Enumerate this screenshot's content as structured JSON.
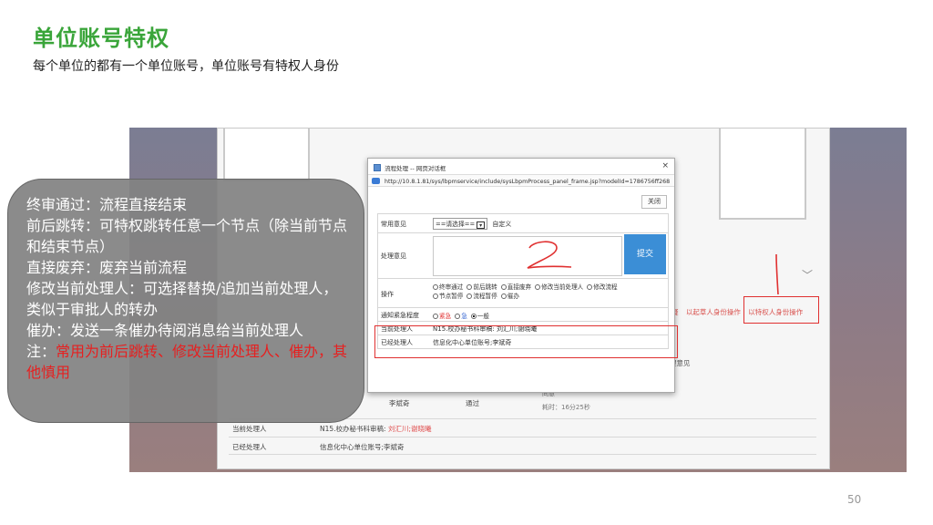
{
  "slide": {
    "title": "单位账号特权",
    "subtitle": "每个单位的都有一个单位账号，单位账号有特权人身份",
    "page_number": "50"
  },
  "callout": {
    "lines": [
      "终审通过：流程直接结束",
      "前后跳转：可特权跳转任意一个节点（除当前节点和结束节点）",
      "直接废弃：废弃当前流程",
      "修改当前处理人：可选择替换/追加当前处理人，类似于审批人的转办",
      "催办：发送一条催办待阅消息给当前处理人"
    ],
    "note_prefix": "注：",
    "note_text": "常用为前后跳转、修改当前处理人、催办，其他慎用"
  },
  "dialog": {
    "title": "流程处理 -- 网页对话框",
    "close_glyph": "×",
    "url": "http://10.8.1.81/sys/lbpmservice/include/sysLbpmProcess_panel_frame.jsp?modelId=1786756ff268",
    "close_button": "关闭",
    "common_opinion_label": "常用意见",
    "common_opinion_select": "==请选择==",
    "common_opinion_custom": "自定义",
    "handle_opinion_label": "处理意见",
    "submit_button": "提交",
    "operation_label": "操作",
    "operations": [
      "终审通过",
      "前后跳转",
      "直接废弃",
      "修改当前处理人",
      "修改流程",
      "节点暂停",
      "流程暂停",
      "催办"
    ],
    "urgency_label": "通知紧急程度",
    "urgency_options": [
      "紧急",
      "急",
      "一般"
    ],
    "current_handler_label": "当前处理人",
    "current_handler_value": "N15.校办秘书科审稿: 刘汇川;谢晓曦",
    "past_handler_label": "已经处理人",
    "past_handler_value": "信息化中心单位账号;李斌奇"
  },
  "background": {
    "links": [
      "疑",
      "以起草人身份操作",
      "以特权人身份操作"
    ],
    "opinion_header": "理意见",
    "name": "李斌奇",
    "status": "通过",
    "elapsed_top": "同意",
    "elapsed": "耗时：16分25秒",
    "current_handler_label": "当前处理人",
    "current_handler_value_prefix": "N15.校办秘书科审稿: ",
    "current_handler_value_red": "刘汇川;谢晓曦",
    "past_handler_label": "已经处理人",
    "past_handler_value": "信息化中心单位账号;李斌奇"
  },
  "colors": {
    "title_green": "#3aa53a",
    "annotation_red": "#e03030",
    "submit_blue": "#3b8ed6"
  }
}
